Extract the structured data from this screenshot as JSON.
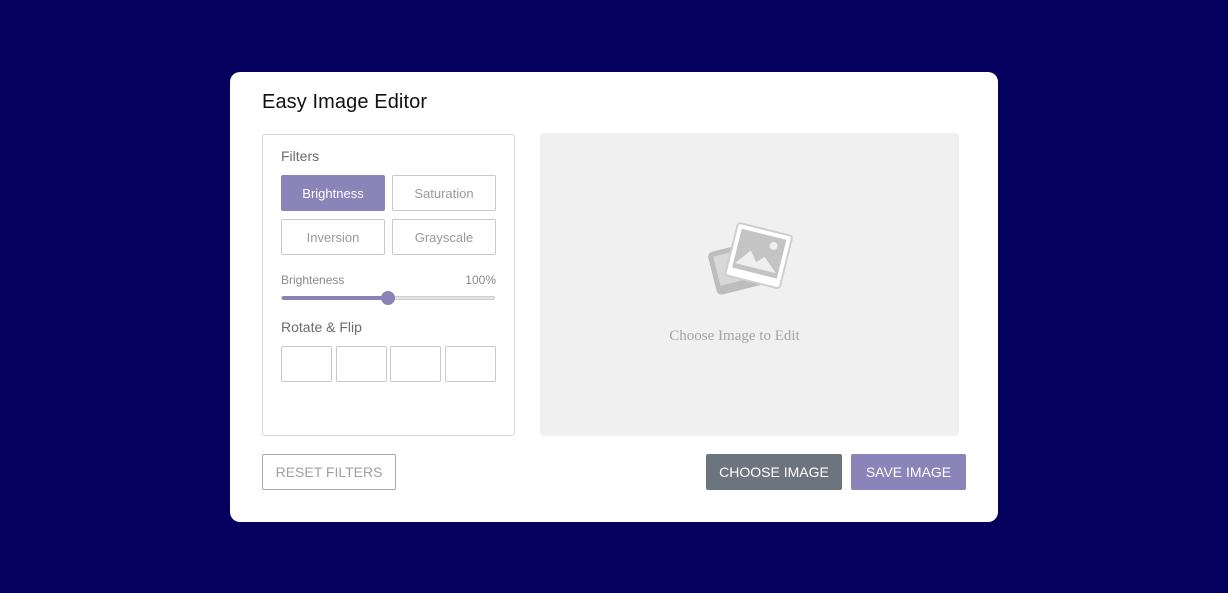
{
  "app": {
    "title": "Easy Image Editor"
  },
  "filters": {
    "label": "Filters",
    "options": [
      {
        "label": "Brightness",
        "active": true
      },
      {
        "label": "Saturation",
        "active": false
      },
      {
        "label": "Inversion",
        "active": false
      },
      {
        "label": "Grayscale",
        "active": false
      }
    ]
  },
  "slider": {
    "name": "Brighteness",
    "value_text": "100%",
    "value_fraction": 0.5
  },
  "rotate": {
    "label": "Rotate & Flip",
    "buttons": [
      {
        "icon": "rotate-left-icon"
      },
      {
        "icon": "rotate-right-icon"
      },
      {
        "icon": "flip-horizontal-icon"
      },
      {
        "icon": "flip-vertical-icon"
      }
    ]
  },
  "preview": {
    "placeholder_text": "Choose Image to Edit",
    "icon": "image-placeholder-icon"
  },
  "actions": {
    "reset_label": "RESET FILTERS",
    "choose_label": "CHOOSE IMAGE",
    "save_label": "SAVE IMAGE"
  },
  "colors": {
    "background": "#04005e",
    "accent": "#8a84b8",
    "secondary": "#6c757d"
  }
}
